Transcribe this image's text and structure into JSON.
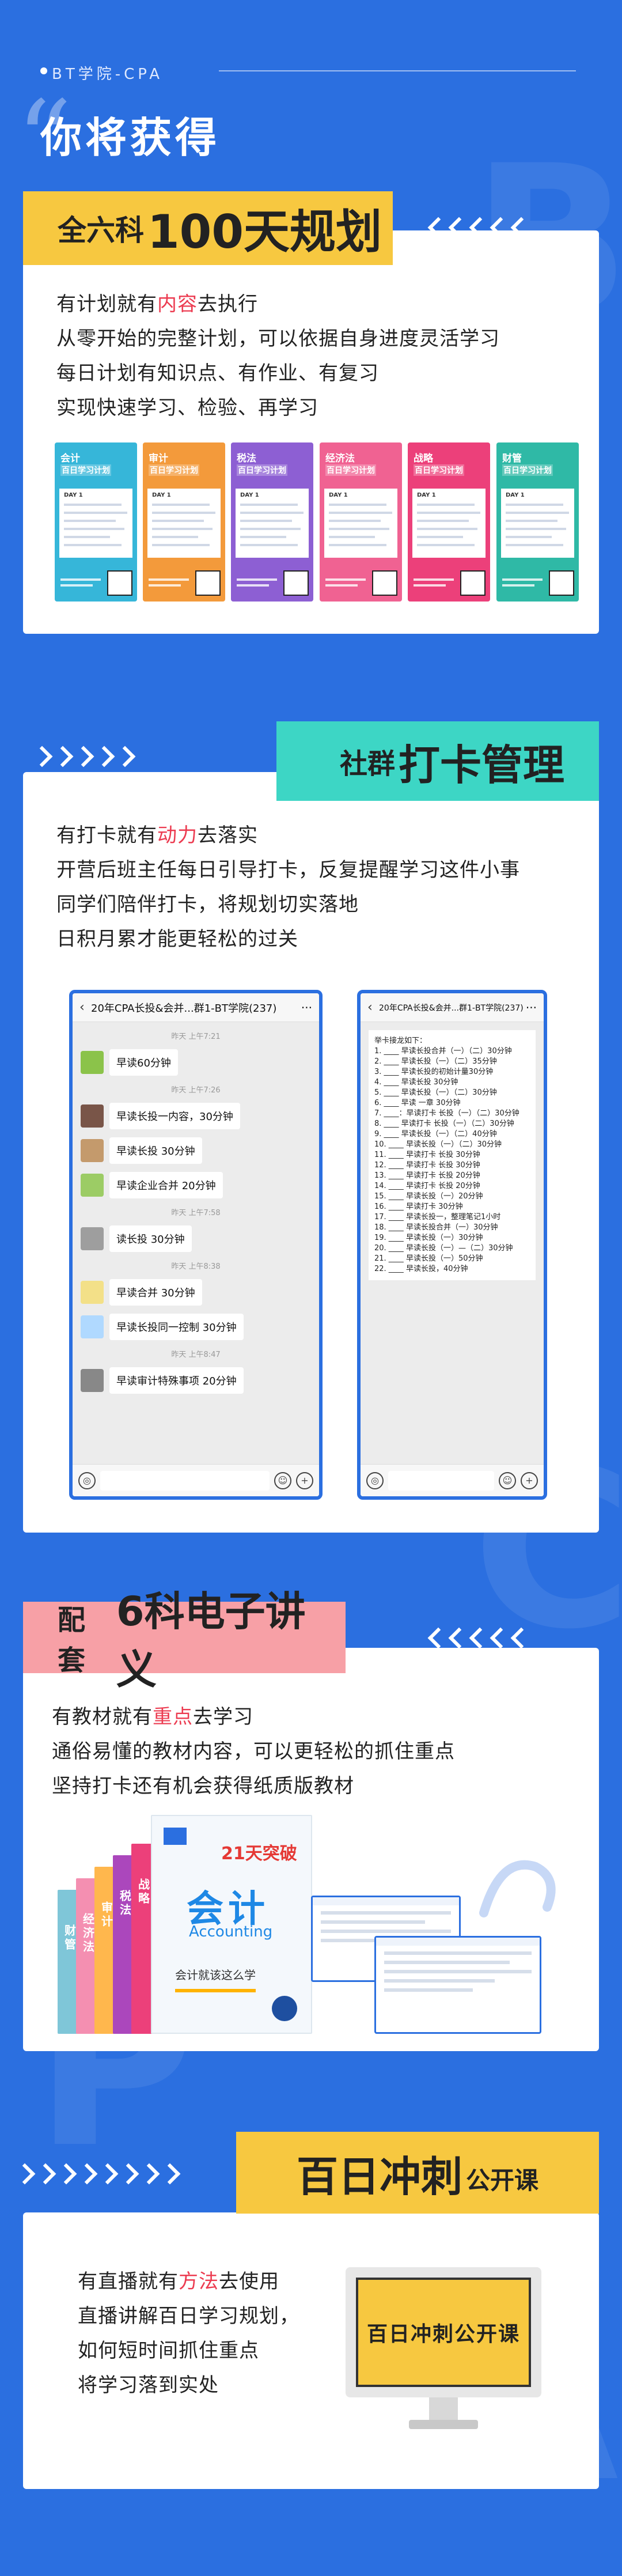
{
  "header": {
    "tag": "BT学院-CPA",
    "title": "你将获得"
  },
  "section1": {
    "banner_prefix": "全六科",
    "banner_big": "100天规划",
    "lines": [
      {
        "before": "有计划就有",
        "highlight": "内容",
        "after": "去执行"
      },
      {
        "before": "从零开始的完整计划，可以依据自身进度灵活学习",
        "highlight": "",
        "after": ""
      },
      {
        "before": "每日计划有知识点、有作业、有复习",
        "highlight": "",
        "after": ""
      },
      {
        "before": "实现快速学习、检验、再学习",
        "highlight": "",
        "after": ""
      }
    ],
    "posters": [
      {
        "subject": "会计",
        "title": "百日学习计划",
        "day": "DAY 1",
        "color": "#36b6d9"
      },
      {
        "subject": "审计",
        "title": "百日学习计划",
        "day": "DAY 1",
        "color": "#f39a3b"
      },
      {
        "subject": "税法",
        "title": "百日学习计划",
        "day": "DAY 1",
        "color": "#8d5fd3"
      },
      {
        "subject": "经济法",
        "title": "百日学习计划",
        "day": "DAY 1",
        "color": "#f06292"
      },
      {
        "subject": "战略",
        "title": "百日学习计划",
        "day": "DAY 1",
        "color": "#ec407a"
      },
      {
        "subject": "财管",
        "title": "百日学习计划",
        "day": "DAY 1",
        "color": "#2fb9a6"
      }
    ]
  },
  "section2": {
    "banner_small": "社群",
    "banner_big": "打卡管理",
    "lines": [
      {
        "before": "有打卡就有",
        "highlight": "动力",
        "after": "去落实"
      },
      {
        "before": "开营后班主任每日引导打卡，反复提醒学习这件小事",
        "highlight": "",
        "after": ""
      },
      {
        "before": "同学们陪伴打卡，将规划切实落地",
        "highlight": "",
        "after": ""
      },
      {
        "before": "日积月累才能更轻松的过关",
        "highlight": "",
        "after": ""
      }
    ],
    "phone_left": {
      "title": "20年CPA长投&会并...群1-BT学院(237)",
      "messages": [
        {
          "time": "昨天 上午7:21",
          "text": "早读60分钟",
          "avatar": "#8bc34a"
        },
        {
          "time": "昨天 上午7:26",
          "text": "早读长投一内容，30分钟",
          "avatar": "#795548"
        },
        {
          "time": "",
          "text": "早读长投 30分钟",
          "avatar": "#c49a6c"
        },
        {
          "time": "",
          "text": "早读企业合并 20分钟",
          "avatar": "#9ccc65"
        },
        {
          "time": "昨天 上午7:58",
          "text": "读长投 30分钟",
          "avatar": "#9e9e9e"
        },
        {
          "time": "昨天 上午8:38",
          "text": "早读合并 30分钟",
          "avatar": "#f3e088"
        },
        {
          "time": "",
          "text": "早读长投同一控制 30分钟",
          "avatar": "#b0d9ff"
        },
        {
          "time": "昨天 上午8:47",
          "text": "早读审计特殊事项 20分钟",
          "avatar": "#888888"
        }
      ]
    },
    "phone_right": {
      "title": "20年CPA长投&会并...群1-BT学院(237)",
      "header_line": "举卡接龙如下：",
      "items": [
        "1. ____ 早读长投合并（一）（二）30分钟",
        "2. ____ 早读长投（一）（二）35分钟",
        "3. ____ 早读长投的初始计量30分钟",
        "4. ____ 早读长投 30分钟",
        "5. ____ 早读长投（一）（二）30分钟",
        "6. ____ 早读 一章 30分钟",
        "7. ____：早读打卡 长投（一）（二）30分钟",
        "8. ____ 早读打卡 长投（一）（二）30分钟",
        "9. ____ 早读长投（一）（二）40分钟",
        "10. ____ 早读长投（一）（二）30分钟",
        "11. ____ 早读打卡 长投 30分钟",
        "12. ____ 早读打卡 长投 30分钟",
        "13. ____ 早读打卡 长投 20分钟",
        "14. ____ 早读打卡 长投 20分钟",
        "15. ____ 早读长投（一）20分钟",
        "16. ____ 早读打卡 30分钟",
        "17. ____ 早读长投一，整理笔记1小时",
        "18. ____ 早读长投合并（一）30分钟",
        "19. ____ 早读长投（一）30分钟",
        "20. ____ 早读长投（一）—（二）30分钟",
        "21. ____ 早读长投（一）50分钟",
        "22. ____ 早读长投，40分钟"
      ]
    }
  },
  "section3": {
    "banner_prefix": "配套",
    "banner_big": "6科电子讲义",
    "lines": [
      {
        "before": "有教材就有",
        "highlight": "重点",
        "after": "去学习"
      },
      {
        "before": "通俗易懂的教材内容，可以更轻松的抓住重点",
        "highlight": "",
        "after": ""
      },
      {
        "before": "坚持打卡还有机会获得纸质版教材",
        "highlight": "",
        "after": ""
      }
    ],
    "books": [
      {
        "name": "财管",
        "color": "#7fc6d8"
      },
      {
        "name": "经济法",
        "color": "#f48fb1"
      },
      {
        "name": "审计",
        "color": "#ffb74d"
      },
      {
        "name": "税法",
        "color": "#ab47bc"
      },
      {
        "name": "战略",
        "color": "#ec407a"
      },
      {
        "name": "会计",
        "color": "#29b6f6"
      }
    ],
    "cover": {
      "badge": "21天突破",
      "title": "会计",
      "subtitle": "Accounting",
      "slogan": "会计就该这么学"
    }
  },
  "section4": {
    "banner_big": "百日冲刺",
    "banner_small": "公开课",
    "lines": [
      {
        "before": "有直播就有",
        "highlight": "方法",
        "after": "去使用"
      },
      {
        "before": "直播讲解百日学习规划，",
        "highlight": "",
        "after": ""
      },
      {
        "before": "如何短时间抓住重点",
        "highlight": "",
        "after": ""
      },
      {
        "before": "将学习落到实处",
        "highlight": "",
        "after": ""
      }
    ],
    "monitor_text": "百日冲刺公开课"
  },
  "colors": {
    "background": "#2b6fe0",
    "accent_yellow": "#f7c840",
    "accent_teal": "#3dd6c5",
    "accent_pink": "#f7a0a6",
    "highlight_red": "#ec3b50"
  }
}
